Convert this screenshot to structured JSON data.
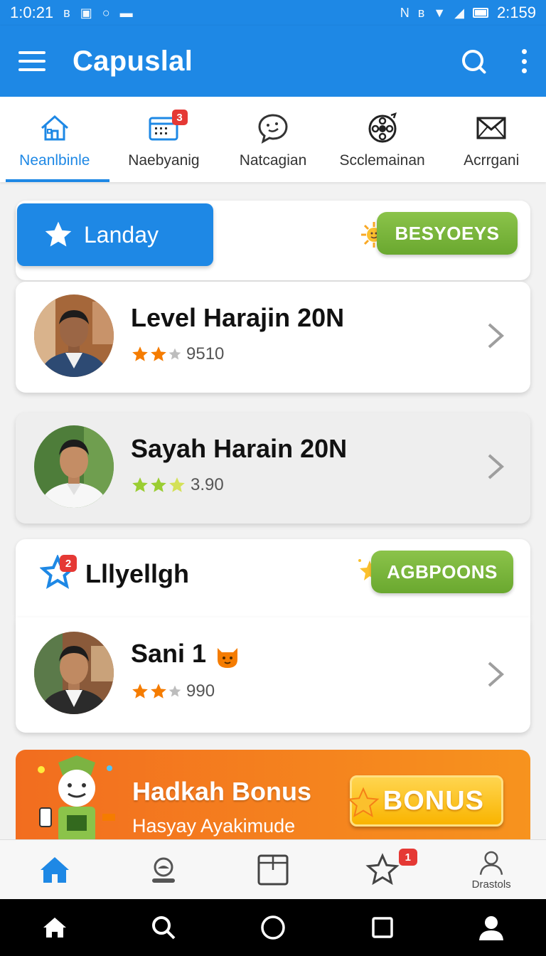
{
  "status_bar": {
    "time_left": "1:0:21",
    "time_right": "2:159"
  },
  "app_bar": {
    "title": "Capuslal"
  },
  "tabs": [
    {
      "label": "Neanlbinle",
      "icon": "home-icon",
      "active": true
    },
    {
      "label": "Naebyanig",
      "icon": "calendar-icon",
      "badge": "3"
    },
    {
      "label": "Natcagian",
      "icon": "chat-icon"
    },
    {
      "label": "Scclemainan",
      "icon": "film-reel-icon"
    },
    {
      "label": "Acrrgani",
      "icon": "mail-icon"
    }
  ],
  "featured": {
    "button_label": "Landay",
    "pill_label": "BESYOEYS"
  },
  "list_items": [
    {
      "title": "Level Harajin 20N",
      "rating": "9510",
      "stars": 2
    },
    {
      "title": "Sayah Harain 20N",
      "rating": "3.90",
      "stars": 3
    },
    {
      "title": "Sani 1",
      "rating": "990",
      "stars": 2
    }
  ],
  "section": {
    "title": "Lllyellgh",
    "badge": "2",
    "pill_label": "AGBPOONS"
  },
  "bonus": {
    "title": "Hadkah Bonus",
    "subtitle": "Hasyay Ayakimude",
    "button_label": "BONUS"
  },
  "bottom_nav": [
    {
      "icon": "home-icon",
      "label": ""
    },
    {
      "icon": "profile-badge-icon",
      "label": ""
    },
    {
      "icon": "box-icon",
      "label": ""
    },
    {
      "icon": "star-icon",
      "label": "",
      "badge": "1"
    },
    {
      "icon": "user-icon",
      "label": "Drastols"
    }
  ],
  "colors": {
    "primary": "#1e88e5",
    "accent_green": "#7cb342",
    "banner_orange": "#f7931e",
    "star_orange": "#f57c00",
    "star_green": "#9acd32"
  }
}
